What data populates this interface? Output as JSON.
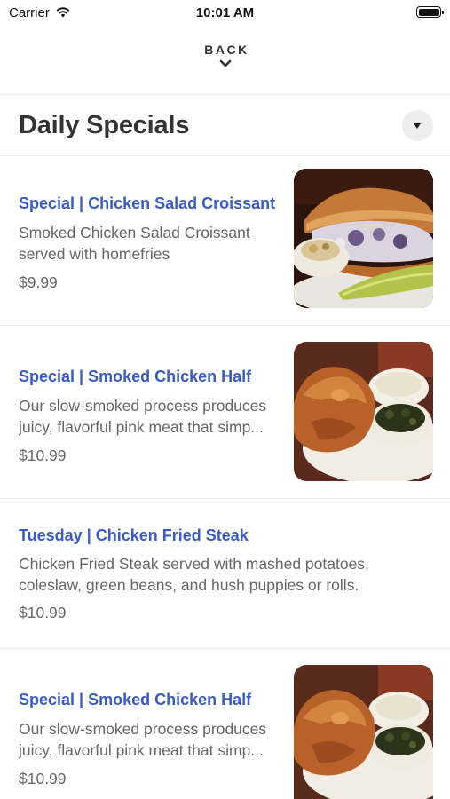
{
  "status_bar": {
    "carrier": "Carrier",
    "time": "10:01 AM",
    "wifi_icon": "wifi-icon",
    "battery_icon": "battery-icon"
  },
  "nav": {
    "back_label": "BACK",
    "back_icon": "chevron-down-icon"
  },
  "header": {
    "title": "Daily Specials",
    "dropdown_icon": "caret-down-icon"
  },
  "menu": {
    "items": [
      {
        "name": "Special | Chicken Salad Croissant",
        "description": "Smoked Chicken Salad Croissant served with homefries",
        "price": "$9.99",
        "photo": "chicken-salad-croissant-photo"
      },
      {
        "name": "Special | Smoked Chicken Half",
        "description": "Our slow-smoked process produces juicy, flavorful pink meat that simp...",
        "price": "$10.99",
        "photo": "smoked-chicken-half-photo"
      },
      {
        "name": "Tuesday | Chicken Fried Steak",
        "description": "Chicken Fried Steak served with mashed potatoes, coleslaw, green beans, and hush puppies or rolls.",
        "price": "$10.99"
      },
      {
        "name": "Special | Smoked Chicken Half",
        "description": "Our slow-smoked process produces juicy, flavorful pink meat that simp...",
        "price": "$10.99",
        "photo": "smoked-chicken-half-photo"
      }
    ]
  },
  "colors": {
    "item_name": "#3a5bc7",
    "body_text": "#666666",
    "title_text": "#333333",
    "divider": "#ebebeb"
  }
}
